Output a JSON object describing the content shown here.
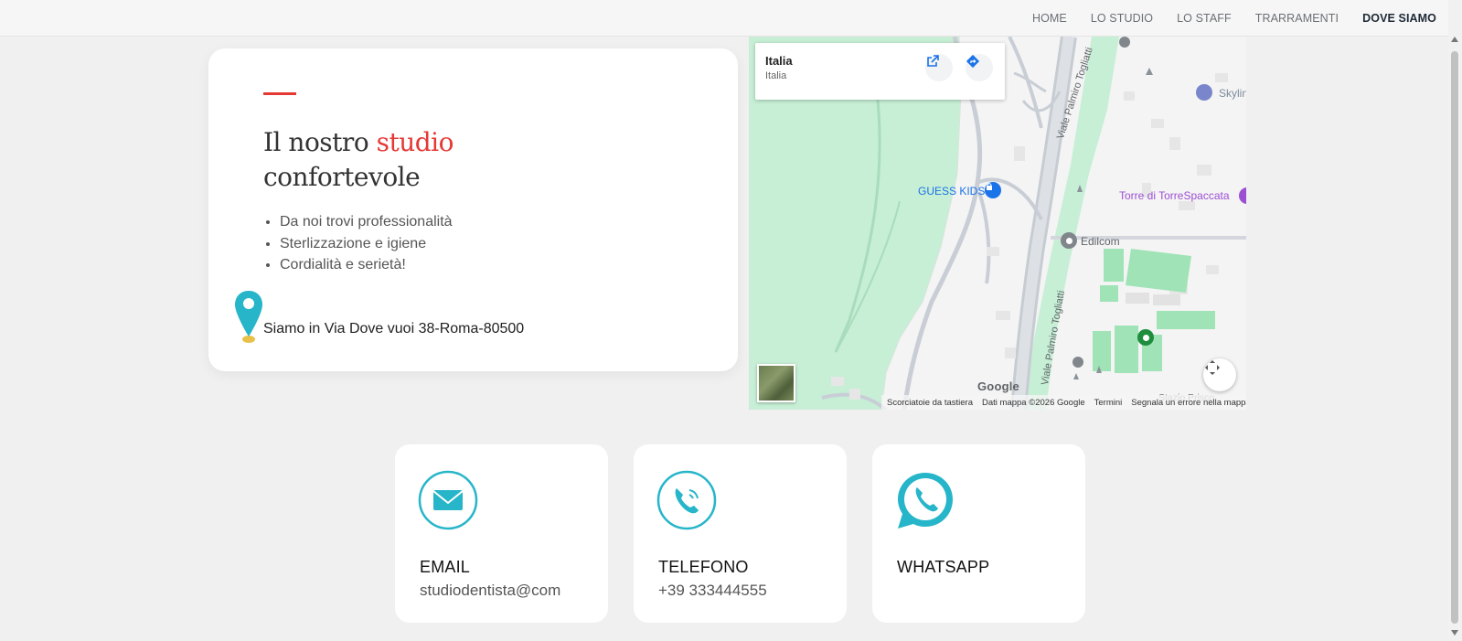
{
  "nav": {
    "items": [
      {
        "label": "HOME",
        "active": false
      },
      {
        "label": "LO STUDIO",
        "active": false
      },
      {
        "label": "LO STAFF",
        "active": false
      },
      {
        "label": "TRARRAMENTI",
        "active": false
      },
      {
        "label": "DOVE SIAMO",
        "active": true
      }
    ]
  },
  "studio": {
    "title_part1": "Il nostro ",
    "title_highlight": "studio",
    "title_part2": "confortevole",
    "features": [
      "Da noi trovi professionalità",
      "Sterlizzazione e igiene",
      "Cordialità e serietà!"
    ],
    "address": "Siamo in Via Dove vuoi 38-Roma-80500"
  },
  "map": {
    "place_name": "Italia",
    "place_sub": "Italia",
    "labels": {
      "guess_kids": "GUESS KIDS",
      "torre": "Torre di TorreSpaccata",
      "edilcom": "Edilcom",
      "skyline": "Skylin",
      "street_top": "Viale Palmiro Togliatti",
      "street_bottom": "Viale Palmiro Togliatti",
      "stazio": "Stazio Prisco"
    },
    "google": "Google",
    "footer": {
      "shortcuts": "Scorciatoie da tastiera",
      "data": "Dati mappa ©2026 Google",
      "terms": "Termini",
      "report": "Segnala un errore nella mappa"
    }
  },
  "contacts": [
    {
      "title": "EMAIL",
      "value": "studiodentista@com",
      "icon": "mail-icon"
    },
    {
      "title": "TELEFONO",
      "value": "+39 333444555",
      "icon": "phone-icon"
    },
    {
      "title": "WHATSAPP",
      "value": "",
      "icon": "whatsapp-icon"
    }
  ],
  "colors": {
    "accent_red": "#e53935",
    "icon_teal": "#26b5c9",
    "map_green": "#c6efd5"
  }
}
